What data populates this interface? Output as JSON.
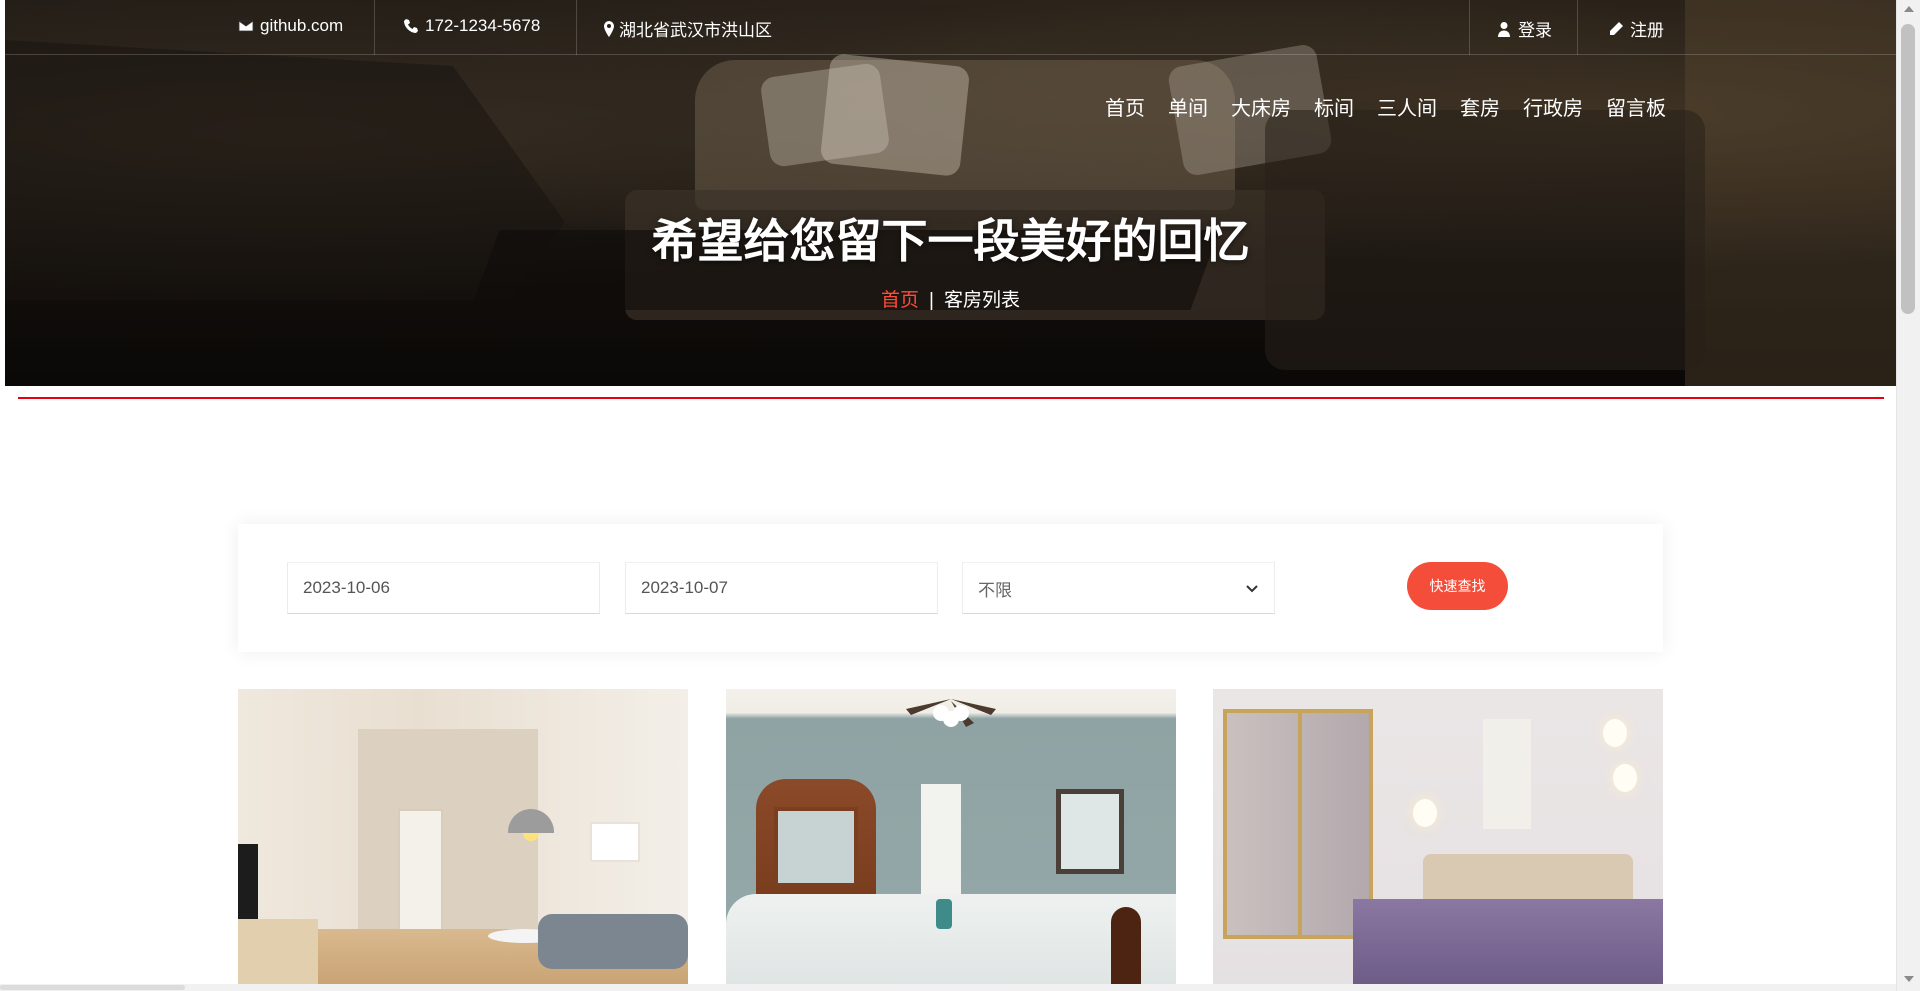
{
  "topbar": {
    "email": "github.com",
    "phone": "172-1234-5678",
    "address": "湖北省武汉市洪山区",
    "login": "登录",
    "register": "注册"
  },
  "nav": {
    "items": [
      "首页",
      "单间",
      "大床房",
      "标间",
      "三人间",
      "套房",
      "行政房",
      "留言板"
    ]
  },
  "hero": {
    "title": "希望给您留下一段美好的回忆",
    "breadcrumb_home": "首页",
    "breadcrumb_separator": "|",
    "breadcrumb_current": "客房列表"
  },
  "search": {
    "checkin": "2023-10-06",
    "checkout": "2023-10-07",
    "room_type": "不限",
    "button": "快速查找"
  },
  "colors": {
    "accent": "#f44e3b",
    "red_line": "#e60012"
  },
  "icons": {
    "email": "envelope-icon",
    "phone": "phone-icon",
    "address": "map-marker-icon",
    "login": "user-icon",
    "register": "pencil-icon"
  }
}
